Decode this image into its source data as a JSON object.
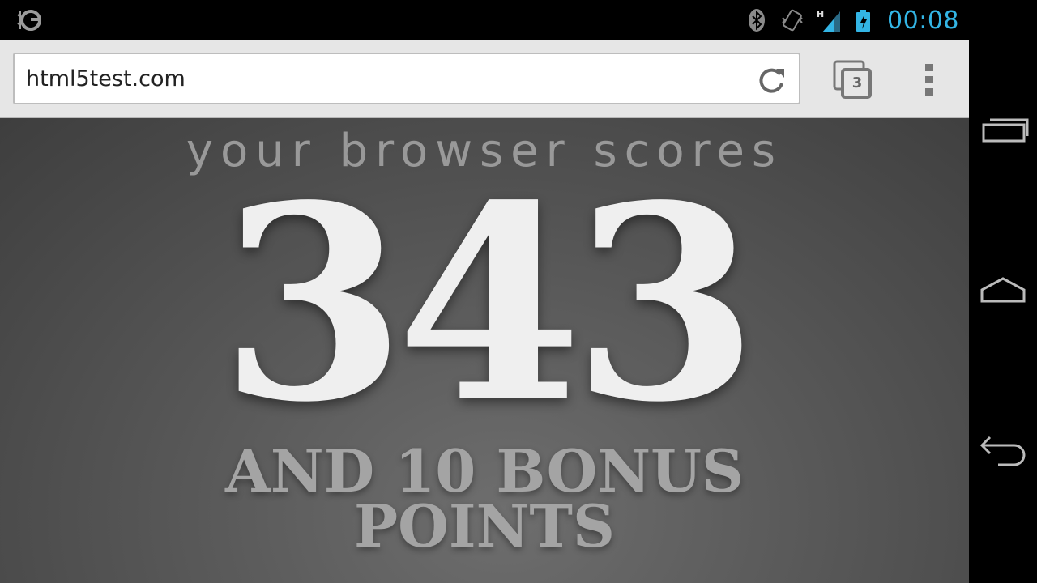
{
  "status_bar": {
    "time": "00:08",
    "icons": [
      "app-notification-icon",
      "bluetooth-icon",
      "vibrate-icon",
      "signal-icon",
      "battery-charging-icon"
    ],
    "network_type": "H",
    "accent_color": "#33b5e5"
  },
  "browser": {
    "url": "html5test.com",
    "tab_count": "3"
  },
  "page": {
    "heading": "your browser scores",
    "score": "343",
    "bonus_line1": "AND 10 BONUS",
    "bonus_line2": "POINTS"
  },
  "nav_bar": {
    "buttons": [
      "recent-apps-icon",
      "home-icon",
      "back-icon"
    ]
  }
}
